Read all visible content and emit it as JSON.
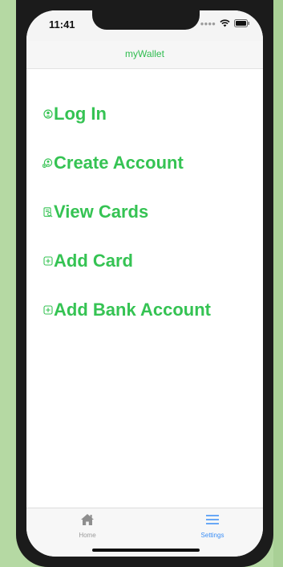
{
  "status_bar": {
    "time": "11:41",
    "icons": [
      "signal-icon",
      "wifi-icon",
      "battery-icon"
    ]
  },
  "nav": {
    "title": "myWallet"
  },
  "menu": {
    "items": [
      {
        "label": "Log In",
        "icon": "user-circle-icon"
      },
      {
        "label": "Create Account",
        "icon": "user-add-icon"
      },
      {
        "label": "View Cards",
        "icon": "document-search-icon"
      },
      {
        "label": "Add Card",
        "icon": "plus-square-icon"
      },
      {
        "label": "Add Bank Account",
        "icon": "plus-square-icon"
      }
    ]
  },
  "tab_bar": {
    "tabs": [
      {
        "label": "Home",
        "icon": "home-icon",
        "selected": false
      },
      {
        "label": "Settings",
        "icon": "menu-lines-icon",
        "selected": true
      }
    ]
  },
  "colors": {
    "accent": "#35c353",
    "tab_selected": "#3a8ef6",
    "tab_unselected": "#9a9a9a",
    "backdrop": "#b5d9a3"
  }
}
